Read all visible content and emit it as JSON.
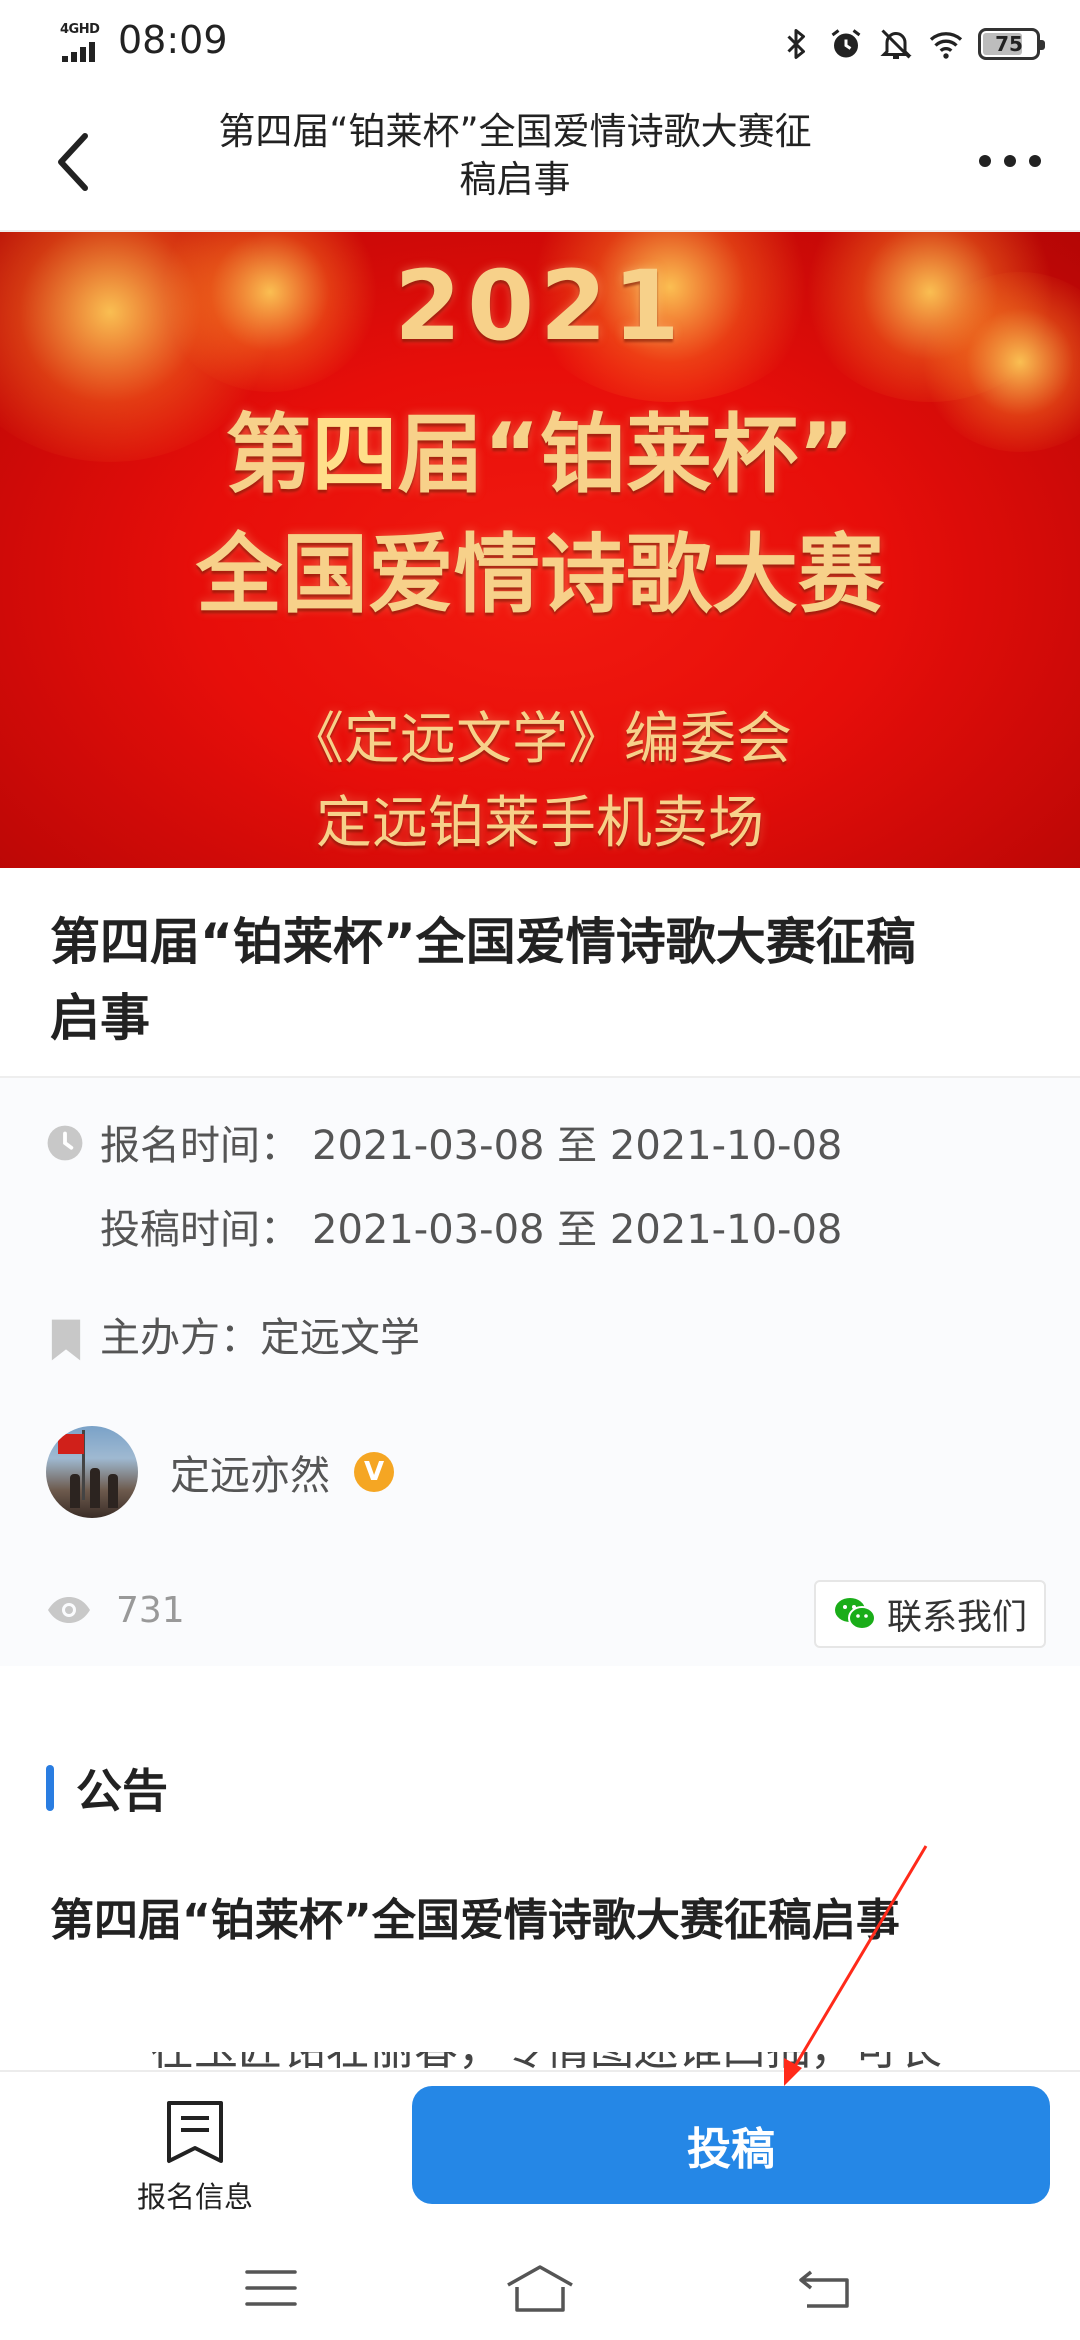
{
  "status_bar": {
    "network_label": "4GHD",
    "time": "08:09",
    "battery_level": "75",
    "battery_percent": 75
  },
  "nav": {
    "title_line1": "第四届“铂莱杯”全国爱情诗歌大赛征",
    "title_line2": "稿启事"
  },
  "banner": {
    "year": "2021",
    "line1_pre": "第",
    "line1_big": "四",
    "line1_post": "届“铂莱杯”",
    "line2": "全国爱情诗歌大赛",
    "line3": "《定远文学》编委会",
    "line4": "定远铂莱手机卖场"
  },
  "article": {
    "title_line1": "第四届“铂莱杯”全国爱情诗歌大赛征稿",
    "title_line2": "启事"
  },
  "info": {
    "signup_label": "报名时间：",
    "signup_value": "2021-03-08 至 2021-10-08",
    "submit_label": "投稿时间：",
    "submit_value": "2021-03-08 至 2021-10-08",
    "organizer": "主办方：定远文学",
    "author_name": "定远亦然",
    "verified_badge": "V",
    "views": "731",
    "contact_label": "联系我们"
  },
  "announcement": {
    "heading": "公告",
    "title": "第四届“铂莱杯”全国爱情诗歌大赛征稿启事",
    "body_first_line": "在玉匠铭壮丽春，专情图迷谁凹抽，可长"
  },
  "action_bar": {
    "signup_info_label": "报名信息",
    "submit_label": "投稿"
  },
  "colors": {
    "accent_blue": "#2587e6",
    "heading_bar": "#2a7de1",
    "verified": "#f5a623",
    "wechat_green": "#1aad19",
    "banner_red": "#e70e0a",
    "annotation_red": "#ff2a1a"
  },
  "icons": {
    "back": "chevron-left-icon",
    "more": "more-dots-icon",
    "clock": "clock-icon",
    "bookmark": "bookmark-icon",
    "eye": "eye-icon",
    "wechat": "wechat-icon",
    "doc": "document-icon",
    "menu": "menu-icon",
    "home": "home-icon",
    "return": "return-icon"
  }
}
